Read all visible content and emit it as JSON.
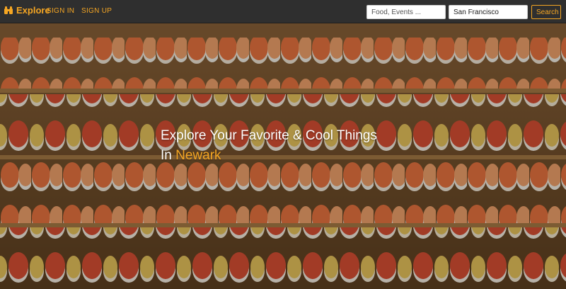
{
  "brand": {
    "name": "Explore",
    "icon": "binoculars-icon",
    "color": "#f5a623"
  },
  "nav": {
    "sign_in": "SIGN IN",
    "sign_up": "SIGN UP"
  },
  "search": {
    "query_placeholder": "Food, Events ...",
    "location_value": "San Francisco",
    "button_label": "Search"
  },
  "hero": {
    "headline_line1": "Explore Your Favorite & Cool Things",
    "headline_in": "In",
    "city": "Newark",
    "background": "sushi-conveyor-photo"
  }
}
